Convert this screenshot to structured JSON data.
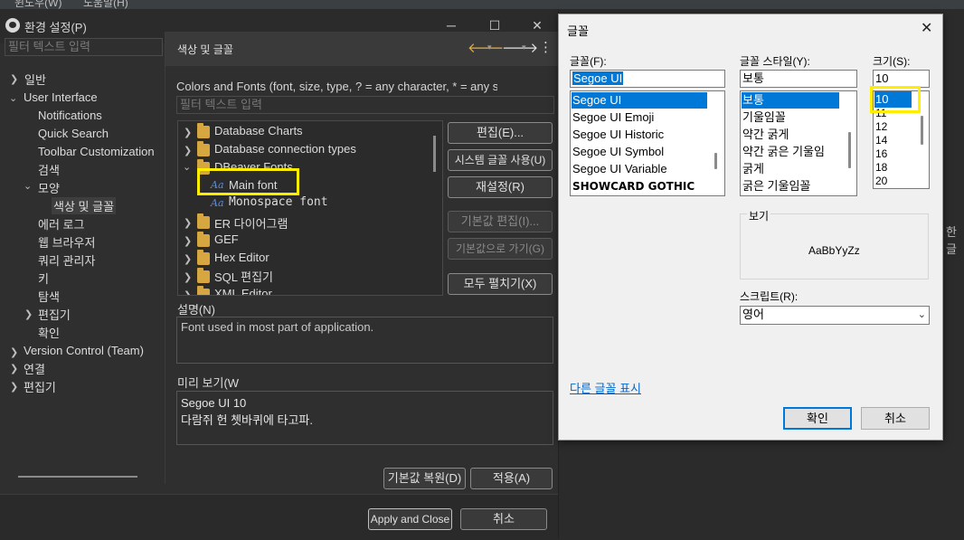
{
  "menubar": {
    "item1": "윈도우(W)",
    "item2": "도움말(H)"
  },
  "prefs": {
    "title": "환경 설정(P)",
    "filter_placeholder": "필터 텍스트 입력",
    "tree": [
      "일반",
      "User Interface",
      "Notifications",
      "Quick Search",
      "Toolbar Customization",
      "검색",
      "모양",
      "색상 및 글꼴",
      "에러 로그",
      "웹 브라우저",
      "쿼리 관리자",
      "키",
      "탐색",
      "편집기",
      "확인",
      "Version Control (Team)",
      "연결",
      "편집기"
    ],
    "page_title": "색상 및 글꼴",
    "description": "Colors and Fonts (font, size, type, ? = any character, * = any s",
    "filter2_placeholder": "필터 텍스트 입력",
    "font_tree": [
      "Database Charts",
      "Database connection types",
      "DBeaver Fonts",
      "Main font",
      "Monospace font",
      "ER 다이어그램",
      "GEF",
      "Hex Editor",
      "SQL 편집기",
      "XML Editor"
    ],
    "buttons": {
      "edit": "편집(E)...",
      "system_font": "시스템 글꼴 사용(U)",
      "reset": "재설정(R)",
      "edit_default": "기본값 편집(I)...",
      "goto_default": "기본값으로 가기(G)",
      "expand_all": "모두 펼치기(X)"
    },
    "desc_label": "설명(N)",
    "desc_value": "Font used in most part of application.",
    "preview_label": "미리 보기(W",
    "preview_line1": "Segoe UI 10",
    "preview_line2": "다람쥐 헌 쳇바퀴에 타고파.",
    "restore_default": "기본값 복원(D)",
    "apply": "적용(A)",
    "apply_close": "Apply and Close",
    "cancel": "취소"
  },
  "right_side_text": "한글",
  "font_dialog": {
    "title": "글꼴",
    "font_label": "글꼴(F):",
    "font_value": "Segoe UI",
    "fonts": [
      "Segoe UI",
      "Segoe UI Emoji",
      "Segoe UI Historic",
      "Segoe UI Symbol",
      "Segoe UI Variable",
      "SHOWCARD GOTHIC"
    ],
    "style_label": "글꼴 스타일(Y):",
    "style_value": "보통",
    "styles": [
      "보통",
      "기울임꼴",
      "약간 굵게",
      "약간 굵은 기울임",
      "굵게",
      "굵은 기울임꼴"
    ],
    "size_label": "크기(S):",
    "size_value": "10",
    "sizes": [
      "10",
      "11",
      "12",
      "14",
      "16",
      "18",
      "20"
    ],
    "sample_label": "보기",
    "sample_text": "AaBbYyZz",
    "script_label": "스크립트(R):",
    "script_value": "영어",
    "more_fonts": "다른 글꼴 표시",
    "ok": "확인",
    "cancel": "취소"
  },
  "colors": {
    "selection": "#0078d7",
    "highlight": "#ffee00"
  }
}
